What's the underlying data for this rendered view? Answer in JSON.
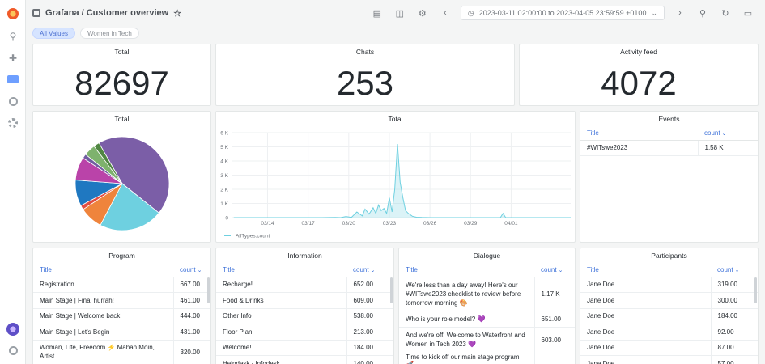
{
  "dashboard": {
    "title": "Grafana / Customer overview",
    "time_range": "2023-03-11 02:00:00 to 2023-04-05 23:59:59 +0100"
  },
  "variables": [
    {
      "label": "All Values",
      "selected": true
    },
    {
      "label": "Women in Tech",
      "selected": false
    }
  ],
  "colors": {
    "accent": "#3d71d9",
    "series": "#6ed0e0"
  },
  "stat_panels": [
    {
      "title": "Total",
      "value": "82697"
    },
    {
      "title": "Chats",
      "value": "253"
    },
    {
      "title": "Activity feed",
      "value": "4072"
    }
  ],
  "pie_panel": {
    "title": "Total"
  },
  "timeseries_panel": {
    "title": "Total"
  },
  "events_panel": {
    "title": "Events",
    "columns": [
      "Title",
      "count"
    ],
    "rows": [
      {
        "title": "#WITswe2023",
        "count": "1.58 K"
      }
    ]
  },
  "program_panel": {
    "title": "Program",
    "columns": [
      "Title",
      "count"
    ],
    "rows": [
      {
        "title": "Registration",
        "count": "667.00"
      },
      {
        "title": "Main Stage | Final hurrah!",
        "count": "461.00"
      },
      {
        "title": "Main Stage | Welcome back!",
        "count": "444.00"
      },
      {
        "title": "Main Stage | Let's Begin",
        "count": "431.00"
      },
      {
        "title": "Woman, Life, Freedom ⚡ Mahan Moin, Artist",
        "count": "320.00"
      }
    ]
  },
  "information_panel": {
    "title": "Information",
    "columns": [
      "Title",
      "count"
    ],
    "rows": [
      {
        "title": "Recharge!",
        "count": "652.00"
      },
      {
        "title": "Food & Drinks",
        "count": "609.00"
      },
      {
        "title": "Other Info",
        "count": "538.00"
      },
      {
        "title": "Floor Plan",
        "count": "213.00"
      },
      {
        "title": "Welcome!",
        "count": "184.00"
      },
      {
        "title": "Helpdesk - Infodesk",
        "count": "140.00"
      }
    ]
  },
  "dialogue_panel": {
    "title": "Dialogue",
    "columns": [
      "Title",
      "count"
    ],
    "rows": [
      {
        "title": "We're less than a day away! Here's our #WITswe2023 checklist to review before tomorrow morning 🎨",
        "count": "1.17 K"
      },
      {
        "title": "Who is your role model? 💜",
        "count": "651.00"
      },
      {
        "title": "And we're off! Welcome to Waterfront and Women in Tech 2023 💜",
        "count": "603.00"
      },
      {
        "title": "Time to kick off our main stage program 🚀",
        "count": ""
      }
    ]
  },
  "participants_panel": {
    "title": "Participants",
    "columns": [
      "Title",
      "count"
    ],
    "rows": [
      {
        "title": "Jane Doe",
        "count": "319.00"
      },
      {
        "title": "Jane Doe",
        "count": "300.00"
      },
      {
        "title": "Jane Doe",
        "count": "184.00"
      },
      {
        "title": "Jane Doe",
        "count": "92.00"
      },
      {
        "title": "Jane Doe",
        "count": "87.00"
      },
      {
        "title": "Jane Doe",
        "count": "57.00"
      }
    ]
  },
  "chart_data": [
    {
      "type": "pie",
      "title": "Total",
      "slices": [
        {
          "value": 44,
          "color": "#7b5ea7"
        },
        {
          "value": 22,
          "color": "#6ed0e0"
        },
        {
          "value": 8,
          "color": "#ef843c"
        },
        {
          "value": 1.5,
          "color": "#e24d42"
        },
        {
          "value": 9,
          "color": "#1f78c1"
        },
        {
          "value": 8,
          "color": "#ba43a9"
        },
        {
          "value": 1.5,
          "color": "#705da0"
        },
        {
          "value": 4,
          "color": "#7eb26d"
        },
        {
          "value": 2,
          "color": "#508642"
        }
      ]
    },
    {
      "type": "area",
      "title": "Total",
      "ylim": [
        0,
        6000
      ],
      "yticks": [
        "0",
        "1 K",
        "2 K",
        "3 K",
        "4 K",
        "5 K",
        "6 K"
      ],
      "xticks": [
        "03/14",
        "03/17",
        "03/20",
        "03/23",
        "03/26",
        "03/29",
        "04/01"
      ],
      "xlim": [
        11.4,
        36.4
      ],
      "series": [
        {
          "name": "AllTypes.count",
          "color": "#6ed0e0",
          "x": [
            11.5,
            15.0,
            18.0,
            19.0,
            19.4,
            19.8,
            20.2,
            20.6,
            21.0,
            21.2,
            21.5,
            21.8,
            22.0,
            22.2,
            22.4,
            22.6,
            22.8,
            23.0,
            23.2,
            23.4,
            23.6,
            23.8,
            24.0,
            24.2,
            24.4,
            24.7,
            25.0,
            25.4,
            26.0,
            27.0,
            28.0,
            30.0,
            31.2,
            31.4,
            31.6,
            33.0,
            36.4
          ],
          "values": [
            0,
            0,
            0,
            20,
            0,
            80,
            20,
            400,
            120,
            600,
            250,
            700,
            300,
            900,
            500,
            650,
            300,
            1400,
            400,
            2000,
            5200,
            2500,
            1400,
            500,
            300,
            100,
            30,
            10,
            0,
            0,
            0,
            0,
            0,
            300,
            0,
            0,
            0
          ]
        }
      ]
    }
  ]
}
